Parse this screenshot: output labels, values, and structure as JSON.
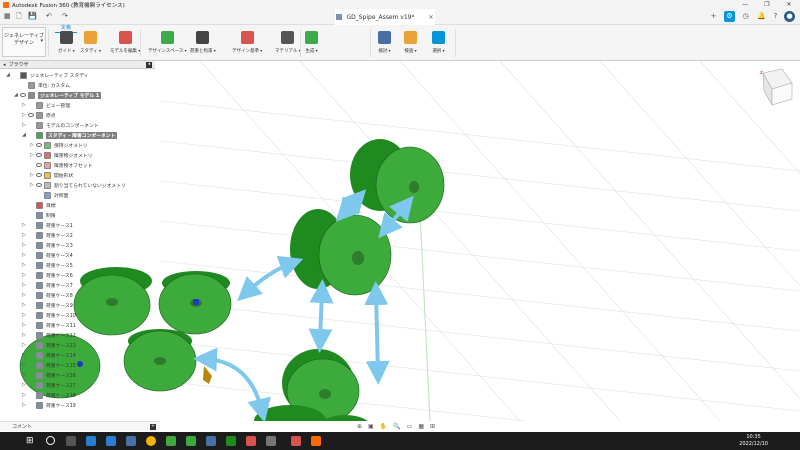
{
  "window": {
    "title": "Autodesk Fusion 360 (教育機関ライセンス)",
    "buttons": [
      "—",
      "❐",
      "✕"
    ]
  },
  "document": {
    "tab_name": "GD_Spipe_Assem v19*"
  },
  "workspace": {
    "line1": "ジェネレーティブ",
    "line2": "デザイン"
  },
  "ribbon": {
    "active_tab": "定義",
    "groups": [
      {
        "label": "ガイド",
        "icon": "crosshair-icon",
        "color": "#4a4a4a"
      },
      {
        "label": "スタディ",
        "icon": "study-icon",
        "color": "#e8a238"
      },
      {
        "label": "モデルを編集",
        "icon": "edit-model-icon",
        "color": "#d9534f"
      },
      {
        "label": "デザインスペース",
        "icon": "design-space-icon",
        "color": "#3cab4c"
      },
      {
        "label": "荷重と拘束",
        "icon": "loads-icon",
        "color": "#444444"
      },
      {
        "label": "デザイン基準",
        "icon": "criteria-icon",
        "color": "#d9534f"
      },
      {
        "label": "マテリアル",
        "icon": "material-icon",
        "color": "#555555"
      },
      {
        "label": "生成",
        "icon": "generate-icon",
        "color": "#3cab4c"
      },
      {
        "label": "検討",
        "icon": "explore-icon",
        "color": "#4a6fa5"
      },
      {
        "label": "検査",
        "icon": "inspect-icon",
        "color": "#e8a238"
      },
      {
        "label": "選択",
        "icon": "select-icon",
        "color": "#0696d7"
      }
    ]
  },
  "browser": {
    "title": "ブラウザ",
    "items": [
      {
        "label": "ジェネレーティブ スタディ",
        "indent": 0,
        "tri": "◢",
        "eye": false,
        "box": "#555555",
        "hl": false
      },
      {
        "label": "単位: カスタム",
        "indent": 1,
        "tri": "",
        "eye": false,
        "box": "#999999",
        "hl": false
      },
      {
        "label": "ジェネレーティブ モデル 1",
        "indent": 1,
        "tri": "◢",
        "eye": true,
        "box": "#888888",
        "hl": true
      },
      {
        "label": "ビュー管理",
        "indent": 2,
        "tri": "▷",
        "eye": false,
        "box": "#9a9a9a",
        "hl": false
      },
      {
        "label": "原点",
        "indent": 2,
        "tri": "▷",
        "eye": true,
        "box": "#9a9a9a",
        "hl": false
      },
      {
        "label": "モデルのコンポーネント",
        "indent": 2,
        "tri": "▷",
        "eye": false,
        "box": "#9a9a9a",
        "hl": false
      },
      {
        "label": "スタディ - 障害コンポーネント",
        "indent": 2,
        "tri": "◢",
        "eye": false,
        "box": "#3cab4c",
        "hl": true
      },
      {
        "label": "保持ジオメトリ",
        "indent": 3,
        "tri": "▷",
        "eye": true,
        "box": "#6fc36f",
        "hl": false
      },
      {
        "label": "障害物ジオメトリ",
        "indent": 3,
        "tri": "▷",
        "eye": true,
        "box": "#e06d6d",
        "hl": false
      },
      {
        "label": "障害物オフセット",
        "indent": 3,
        "tri": "",
        "eye": true,
        "box": "#e9a0a0",
        "hl": false
      },
      {
        "label": "開始形状",
        "indent": 3,
        "tri": "▷",
        "eye": true,
        "box": "#f0c040",
        "hl": false
      },
      {
        "label": "割り当てられていないジオメトリ",
        "indent": 3,
        "tri": "▷",
        "eye": true,
        "box": "#bbbbbb",
        "hl": false
      },
      {
        "label": "対称面",
        "indent": 3,
        "tri": "",
        "eye": false,
        "box": "#7aa7d9",
        "hl": false
      },
      {
        "label": "目標",
        "indent": 2,
        "tri": "",
        "eye": false,
        "box": "#d9534f",
        "hl": false
      },
      {
        "label": "制限",
        "indent": 2,
        "tri": "",
        "eye": false,
        "box": "#7f8fa6",
        "hl": false
      },
      {
        "label": "荷重ケース1",
        "indent": 2,
        "tri": "▷",
        "eye": false,
        "box": "#7f8fa6",
        "hl": false
      },
      {
        "label": "荷重ケース2",
        "indent": 2,
        "tri": "▷",
        "eye": false,
        "box": "#7f8fa6",
        "hl": false
      },
      {
        "label": "荷重ケース3",
        "indent": 2,
        "tri": "▷",
        "eye": false,
        "box": "#7f8fa6",
        "hl": false
      },
      {
        "label": "荷重ケース4",
        "indent": 2,
        "tri": "▷",
        "eye": false,
        "box": "#7f8fa6",
        "hl": false
      },
      {
        "label": "荷重ケース5",
        "indent": 2,
        "tri": "▷",
        "eye": false,
        "box": "#7f8fa6",
        "hl": false
      },
      {
        "label": "荷重ケース6",
        "indent": 2,
        "tri": "▷",
        "eye": false,
        "box": "#7f8fa6",
        "hl": false
      },
      {
        "label": "荷重ケース7",
        "indent": 2,
        "tri": "▷",
        "eye": false,
        "box": "#7f8fa6",
        "hl": false
      },
      {
        "label": "荷重ケース8",
        "indent": 2,
        "tri": "▷",
        "eye": false,
        "box": "#7f8fa6",
        "hl": false
      },
      {
        "label": "荷重ケース9",
        "indent": 2,
        "tri": "▷",
        "eye": false,
        "box": "#7f8fa6",
        "hl": false
      },
      {
        "label": "荷重ケース10",
        "indent": 2,
        "tri": "▷",
        "eye": false,
        "box": "#7f8fa6",
        "hl": false
      },
      {
        "label": "荷重ケース11",
        "indent": 2,
        "tri": "▷",
        "eye": false,
        "box": "#7f8fa6",
        "hl": false
      },
      {
        "label": "荷重ケース12",
        "indent": 2,
        "tri": "▷",
        "eye": false,
        "box": "#7f8fa6",
        "hl": false
      },
      {
        "label": "荷重ケース13",
        "indent": 2,
        "tri": "▷",
        "eye": false,
        "box": "#7f8fa6",
        "hl": false
      },
      {
        "label": "荷重ケース14",
        "indent": 2,
        "tri": "▷",
        "eye": false,
        "box": "#7f8fa6",
        "hl": false
      },
      {
        "label": "荷重ケース15",
        "indent": 2,
        "tri": "▷",
        "eye": false,
        "box": "#7f8fa6",
        "hl": false
      },
      {
        "label": "荷重ケース16",
        "indent": 2,
        "tri": "▷",
        "eye": false,
        "box": "#7f8fa6",
        "hl": false
      },
      {
        "label": "荷重ケース17",
        "indent": 2,
        "tri": "▷",
        "eye": false,
        "box": "#7f8fa6",
        "hl": false
      },
      {
        "label": "荷重ケース18",
        "indent": 2,
        "tri": "▷",
        "eye": false,
        "box": "#7f8fa6",
        "hl": false
      },
      {
        "label": "荷重ケース19",
        "indent": 2,
        "tri": "▷",
        "eye": false,
        "box": "#7f8fa6",
        "hl": false
      }
    ]
  },
  "comments": {
    "label": "コメント"
  },
  "taskbar": {
    "time": "10:35",
    "date": "2022/12/10"
  },
  "colors": {
    "accent": "#0696d7",
    "part": "#3cab3c",
    "arrow": "#7ec8ee"
  }
}
